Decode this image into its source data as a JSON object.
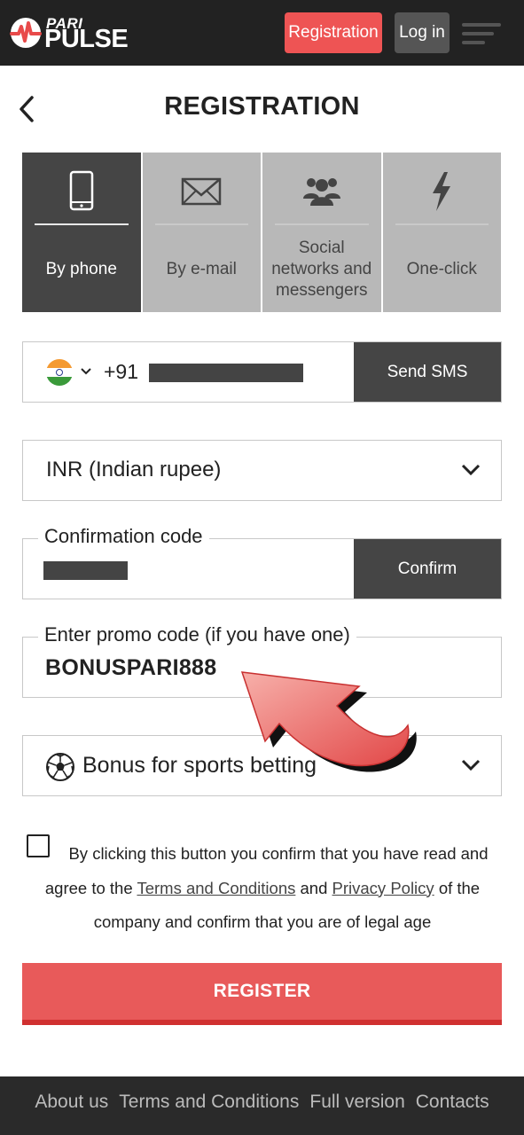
{
  "header": {
    "logo_top": "PARI",
    "logo_bottom": "PULSE",
    "registration_label": "Registration",
    "login_label": "Log in"
  },
  "page": {
    "title": "REGISTRATION"
  },
  "tabs": [
    {
      "label": "By phone",
      "icon": "phone-icon",
      "active": true
    },
    {
      "label": "By e-mail",
      "icon": "envelope-icon",
      "active": false
    },
    {
      "label": "Social networks and messengers",
      "icon": "users-icon",
      "active": false
    },
    {
      "label": "One-click",
      "icon": "lightning-icon",
      "active": false
    }
  ],
  "phone": {
    "country_flag": "india-flag-icon",
    "prefix": "+91",
    "send_sms_label": "Send SMS"
  },
  "currency": {
    "selected": "INR (Indian rupee)"
  },
  "confirmation": {
    "label": "Confirmation code",
    "confirm_label": "Confirm"
  },
  "promo": {
    "label": "Enter promo code (if you have one)",
    "value": "BONUSPARI888"
  },
  "bonus": {
    "selected": "Bonus for sports betting",
    "icon": "soccer-ball-icon"
  },
  "agreement": {
    "text_1": "By clicking this button you confirm that you have read and agree to the",
    "terms_link": "Terms and Conditions",
    "and": "and",
    "privacy_link": "Privacy Policy",
    "text_2": "of the company and confirm that you are of legal age"
  },
  "register_label": "REGISTER",
  "footer": {
    "links": [
      "About us",
      "Terms and Conditions",
      "Full version",
      "Contacts"
    ]
  },
  "colors": {
    "accent": "#ee5454",
    "dark": "#222222",
    "tab_active": "#454545",
    "tab_inactive": "#b8b8b8"
  }
}
